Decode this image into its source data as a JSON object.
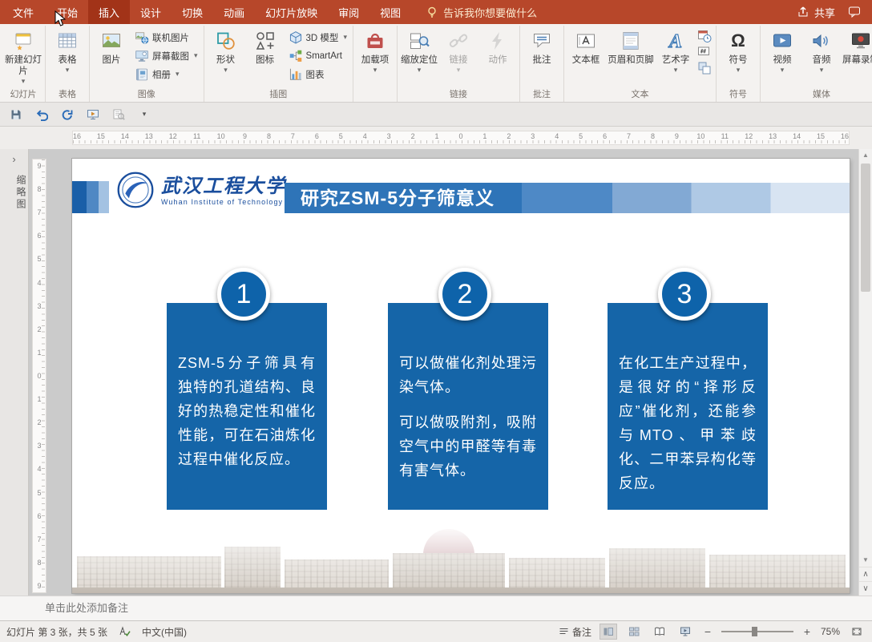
{
  "tabs": {
    "file": "文件",
    "home": "开始",
    "insert": "插入",
    "design": "设计",
    "transitions": "切换",
    "animations": "动画",
    "slideshow": "幻灯片放映",
    "review": "审阅",
    "view": "视图",
    "tellme": "告诉我你想要做什么",
    "share": "共享"
  },
  "ribbon": {
    "groups": {
      "slides": {
        "name": "幻灯片",
        "new_slide": "新建幻灯片"
      },
      "tables": {
        "name": "表格",
        "table": "表格"
      },
      "images": {
        "name": "图像",
        "picture": "图片",
        "online_pictures": "联机图片",
        "screenshot": "屏幕截图",
        "photo_album": "相册"
      },
      "illustrations": {
        "name": "插图",
        "shapes": "形状",
        "icons": "图标",
        "model_3d": "3D 模型",
        "smartart": "SmartArt",
        "chart": "图表"
      },
      "addins": {
        "name": "",
        "addins": "加载项"
      },
      "links": {
        "name": "链接",
        "zoom": "缩放定位",
        "link": "链接",
        "action": "动作"
      },
      "comments": {
        "name": "批注",
        "comment": "批注"
      },
      "text": {
        "name": "文本",
        "text_box": "文本框",
        "header_footer": "页眉和页脚",
        "wordart": "艺术字"
      },
      "symbols": {
        "name": "符号",
        "symbol": "符号",
        "omega": "Ω"
      },
      "media": {
        "name": "媒体",
        "video": "视频",
        "audio": "音频",
        "screen_recording": "屏幕录制"
      }
    }
  },
  "panel": {
    "thumbnails_label": "缩略图"
  },
  "rulers": {
    "horizontal": [
      16,
      15,
      14,
      13,
      12,
      11,
      10,
      9,
      8,
      7,
      6,
      5,
      4,
      3,
      2,
      1,
      0,
      1,
      2,
      3,
      4,
      5,
      6,
      7,
      8,
      9,
      10,
      11,
      12,
      13,
      14,
      15,
      16
    ],
    "vertical": [
      9,
      8,
      7,
      6,
      5,
      4,
      3,
      2,
      1,
      0,
      1,
      2,
      3,
      4,
      5,
      6,
      7,
      8,
      9
    ]
  },
  "slide": {
    "logo": {
      "cn": "武汉工程大学",
      "en": "Wuhan Institute of Technology"
    },
    "title": "研究ZSM-5分子筛意义",
    "cards": [
      {
        "num": "1",
        "paras": [
          "ZSM-5分子筛具有独特的孔道结构、良好的热稳定性和催化性能，可在石油炼化过程中催化反应。"
        ]
      },
      {
        "num": "2",
        "paras": [
          "可以做催化剂处理污染气体。",
          "可以做吸附剂，吸附空气中的甲醛等有毒有害气体。"
        ]
      },
      {
        "num": "3",
        "paras": [
          "在化工生产过程中，是很好的“择形反应”催化剂，还能参与MTO、甲苯歧化、二甲苯异构化等反应。"
        ]
      }
    ]
  },
  "notes": {
    "placeholder": "单击此处添加备注"
  },
  "statusbar": {
    "slide_info": "幻灯片 第 3 张，共 5 张",
    "language": "中文(中国)",
    "notes_label": "备注",
    "zoom_percent": "75%"
  },
  "icons": {
    "caret": "▾",
    "chevron_right": "›",
    "scroll_up": "▲",
    "scroll_down": "▼",
    "prev_slide": "∧",
    "next_slide": "∨",
    "zoom_out": "−",
    "zoom_in": "+"
  },
  "colors": {
    "ribbon_red": "#B7472A",
    "active_tab_red": "#A23318",
    "banner_blue": "#2E74B8",
    "card_blue": "#1565A8",
    "circle_blue": "#0E63AA",
    "logo_blue": "#1A4E9D"
  }
}
